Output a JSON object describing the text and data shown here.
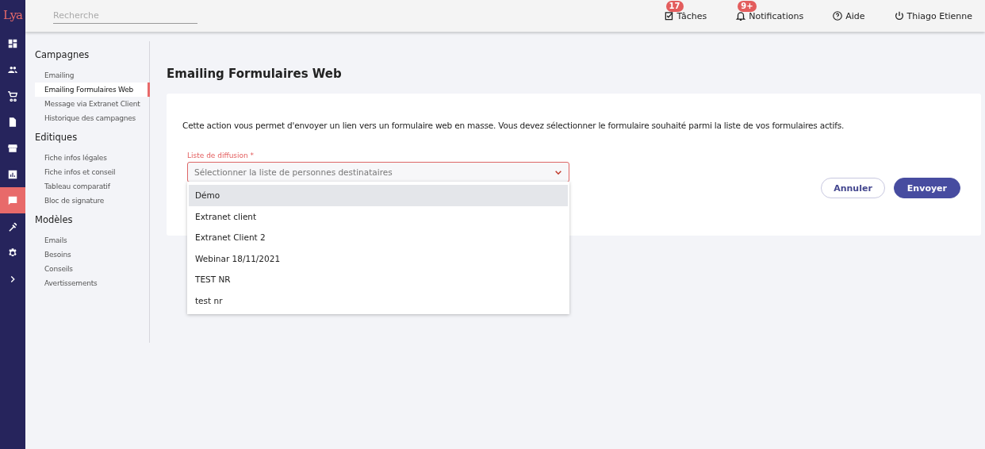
{
  "logo": "Lya",
  "rail": [
    {
      "kind": "dashboard",
      "selected": false
    },
    {
      "kind": "people",
      "selected": false
    },
    {
      "kind": "cart",
      "selected": false
    },
    {
      "kind": "document",
      "selected": false
    },
    {
      "kind": "store",
      "selected": false
    },
    {
      "kind": "chart",
      "selected": false
    },
    {
      "kind": "chat",
      "selected": true
    },
    {
      "kind": "tools",
      "selected": false
    },
    {
      "kind": "settings",
      "selected": false
    },
    {
      "kind": "expand",
      "selected": false
    }
  ],
  "search": {
    "placeholder": "Recherche"
  },
  "topbar": [
    {
      "kind": "tasks",
      "label": "Tâches",
      "badge": "17"
    },
    {
      "kind": "bell",
      "label": "Notifications",
      "badge": "9+"
    },
    {
      "kind": "help",
      "label": "Aide"
    },
    {
      "kind": "power",
      "label": "Thiago Etienne"
    }
  ],
  "sidebar": [
    {
      "title": "Campagnes",
      "items": [
        {
          "label": "Emailing",
          "selected": false
        },
        {
          "label": "Emailing Formulaires Web",
          "selected": true
        },
        {
          "label": "Message via Extranet Client",
          "selected": false
        },
        {
          "label": "Historique des campagnes",
          "selected": false
        }
      ]
    },
    {
      "title": "Editiques",
      "items": [
        {
          "label": "Fiche infos légales",
          "selected": false
        },
        {
          "label": "Fiche infos et conseil",
          "selected": false
        },
        {
          "label": "Tableau comparatif",
          "selected": false
        },
        {
          "label": "Bloc de signature",
          "selected": false
        }
      ]
    },
    {
      "title": "Modèles",
      "items": [
        {
          "label": "Emails",
          "selected": false
        },
        {
          "label": "Besoins",
          "selected": false
        },
        {
          "label": "Conseils",
          "selected": false
        },
        {
          "label": "Avertissements",
          "selected": false
        }
      ]
    }
  ],
  "page_title": "Emailing Formulaires Web",
  "description": "Cette action vous permet d'envoyer un lien vers un formulaire web en masse. Vous devez sélectionner le formulaire souhaité parmi la liste de vos formulaires actifs.",
  "field": {
    "label": "Liste de diffusion *",
    "placeholder": "Sélectionner la liste de personnes destinataires",
    "expanded": true,
    "options": [
      {
        "label": "Démo",
        "selected": true
      },
      {
        "label": "Extranet client",
        "selected": false
      },
      {
        "label": "Extranet Client 2",
        "selected": false
      },
      {
        "label": "Webinar 18/11/2021",
        "selected": false
      },
      {
        "label": "TEST NR",
        "selected": false
      },
      {
        "label": "test nr",
        "selected": false
      }
    ]
  },
  "buttons": [
    {
      "kind": "secondary",
      "label": "Annuler"
    },
    {
      "kind": "primary",
      "label": "Envoyer"
    }
  ]
}
